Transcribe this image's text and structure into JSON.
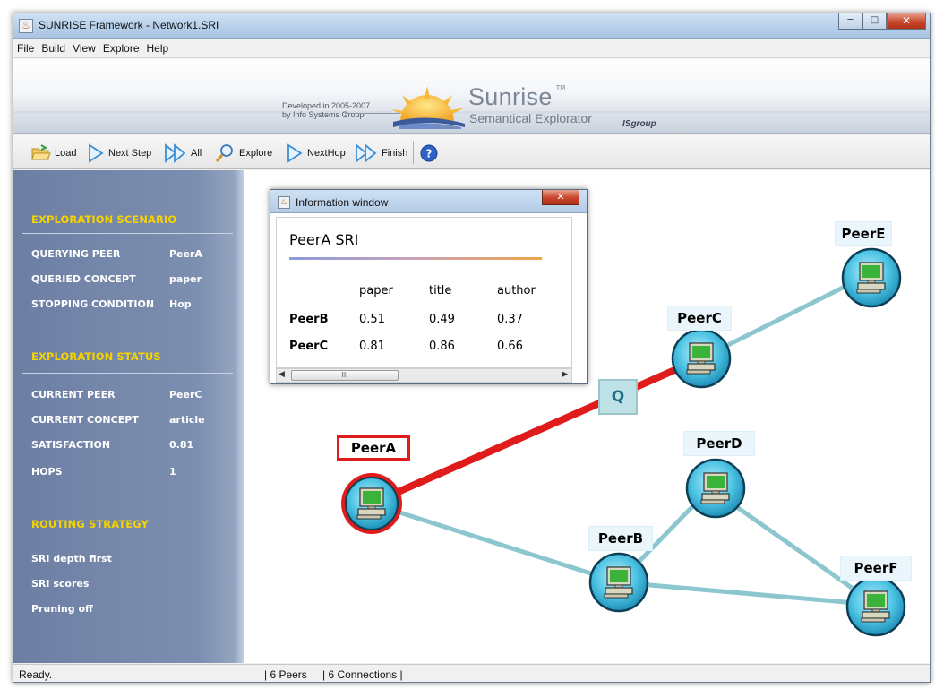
{
  "window": {
    "title": "SUNRISE Framework - Network1.SRI"
  },
  "menu": [
    "File",
    "Build",
    "View",
    "Explore",
    "Help"
  ],
  "banner": {
    "developed_line1": "Developed in 2005-2007",
    "developed_line2": "by Info Systems Group",
    "brand": "Sunrise",
    "tm": "TM",
    "subtitle": "Semantical Explorator",
    "group": "ISgroup"
  },
  "toolbar": {
    "load": "Load",
    "next_step": "Next Step",
    "all": "All",
    "explore": "Explore",
    "next_hop": "NextHop",
    "finish": "Finish"
  },
  "sidebar": {
    "scenario_header": "EXPLORATION SCENARIO",
    "scenario": [
      {
        "label": "QUERYING PEER",
        "value": "PeerA"
      },
      {
        "label": "QUERIED CONCEPT",
        "value": "paper"
      },
      {
        "label": "STOPPING CONDITION",
        "value": "Hop"
      }
    ],
    "status_header": "EXPLORATION STATUS",
    "status": [
      {
        "label": "CURRENT PEER",
        "value": "PeerC"
      },
      {
        "label": "CURRENT CONCEPT",
        "value": "article"
      },
      {
        "label": "SATISFACTION",
        "value": "0.81"
      },
      {
        "label": "HOPS",
        "value": "1"
      }
    ],
    "routing_header": "ROUTING STRATEGY",
    "routing": [
      "SRI depth first",
      "SRI scores",
      "Pruning off"
    ]
  },
  "info_window": {
    "title": "Information window",
    "sri_title": "PeerA SRI",
    "columns": [
      "paper",
      "title",
      "author"
    ],
    "rows": [
      {
        "peer": "PeerB",
        "values": [
          "0.51",
          "0.49",
          "0.37"
        ]
      },
      {
        "peer": "PeerC",
        "values": [
          "0.81",
          "0.86",
          "0.66"
        ]
      }
    ],
    "scroll_thumb": "III"
  },
  "network": {
    "peers": [
      "PeerA",
      "PeerB",
      "PeerC",
      "PeerD",
      "PeerE",
      "PeerF"
    ],
    "selected_peer": "PeerA",
    "query_marker": "Q",
    "active_link_color": "#e01b1b",
    "link_color": "#8cc6cf"
  },
  "status": {
    "text": "Ready.",
    "peers": "| 6 Peers",
    "connections": "| 6 Connections |"
  }
}
